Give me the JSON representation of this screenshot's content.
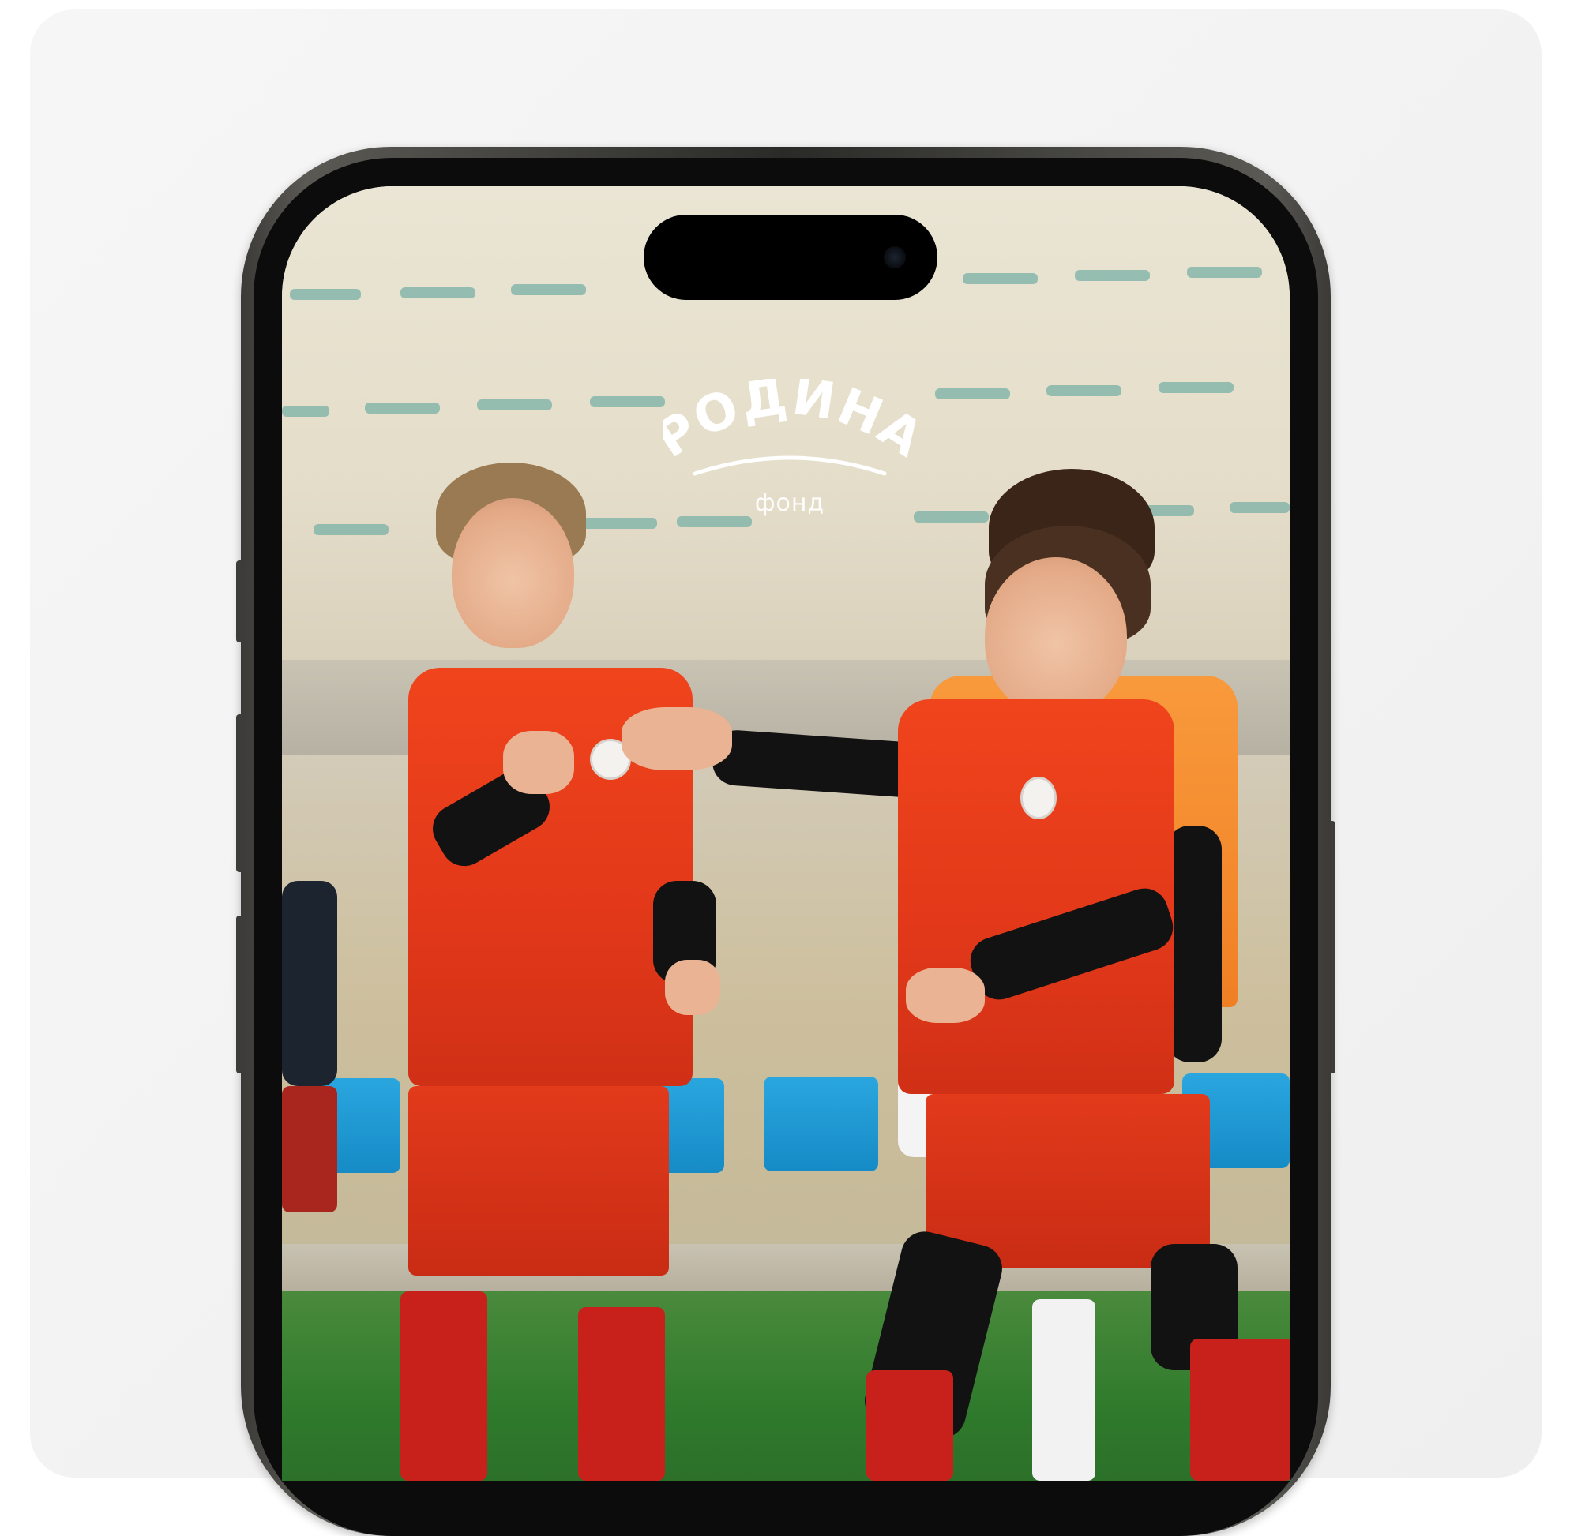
{
  "logo": {
    "title": "РОДИНА",
    "subtitle": "фонд"
  },
  "colors": {
    "background": "#f4f4f4",
    "jersey_red": "#e83c1b",
    "jersey_orange": "#f28a2e",
    "seat_blue": "#1e9bd7",
    "phone_frame": "#3b3a37"
  },
  "icons": [
    "camera-icon",
    "logo-arc"
  ]
}
